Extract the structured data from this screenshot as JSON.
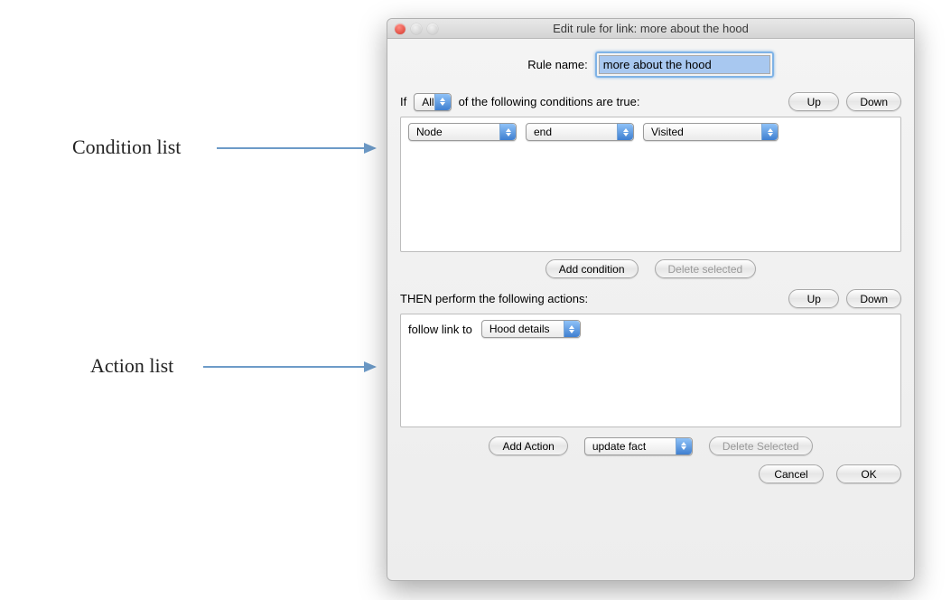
{
  "annotations": {
    "condition_list": "Condition list",
    "action_list": "Action list"
  },
  "titlebar": {
    "title": "Edit rule for link: more about the hood"
  },
  "rule_name": {
    "label": "Rule name:",
    "value": "more about the hood"
  },
  "conditions": {
    "if_label": "If",
    "quantifier": "All",
    "tail_label": "of the following conditions are true:",
    "up": "Up",
    "down": "Down",
    "rows": [
      {
        "subject": "Node",
        "target": "end",
        "state": "Visited"
      }
    ],
    "add_button": "Add condition",
    "delete_button": "Delete selected"
  },
  "actions": {
    "then_label": "THEN perform the following actions:",
    "up": "Up",
    "down": "Down",
    "rows": [
      {
        "prefix": "follow link to",
        "target": "Hood details"
      }
    ],
    "add_button": "Add Action",
    "type_select": "update fact",
    "delete_button": "Delete Selected"
  },
  "footer": {
    "cancel": "Cancel",
    "ok": "OK"
  }
}
